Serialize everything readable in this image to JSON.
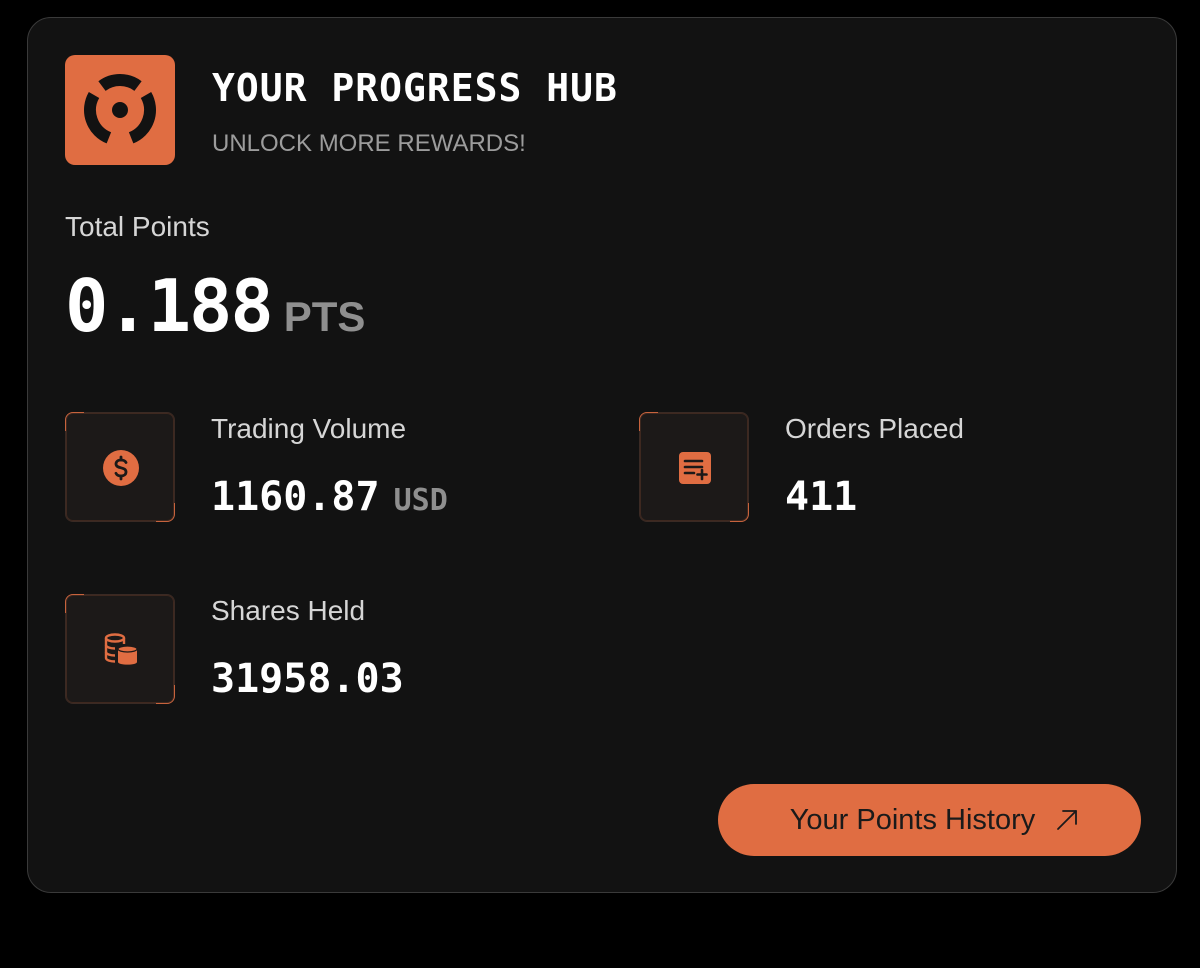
{
  "header": {
    "title": "YOUR PROGRESS HUB",
    "subtitle": "UNLOCK MORE REWARDS!",
    "logo_icon": "ring-segments-icon"
  },
  "total": {
    "label": "Total Points",
    "value": "0.188",
    "unit": "PTS"
  },
  "stats": {
    "trading_volume": {
      "label": "Trading Volume",
      "value": "1160.87",
      "unit": "USD",
      "icon": "dollar-coin-icon"
    },
    "orders_placed": {
      "label": "Orders Placed",
      "value": "411",
      "icon": "list-add-icon"
    },
    "shares_held": {
      "label": "Shares Held",
      "value": "31958.03",
      "icon": "coin-stack-icon"
    }
  },
  "actions": {
    "history_label": "Your Points History",
    "history_icon": "arrow-up-right-icon"
  },
  "colors": {
    "accent": "#e06d42",
    "background": "#000000",
    "card": "#121212",
    "muted_text": "#8f8f8f"
  }
}
